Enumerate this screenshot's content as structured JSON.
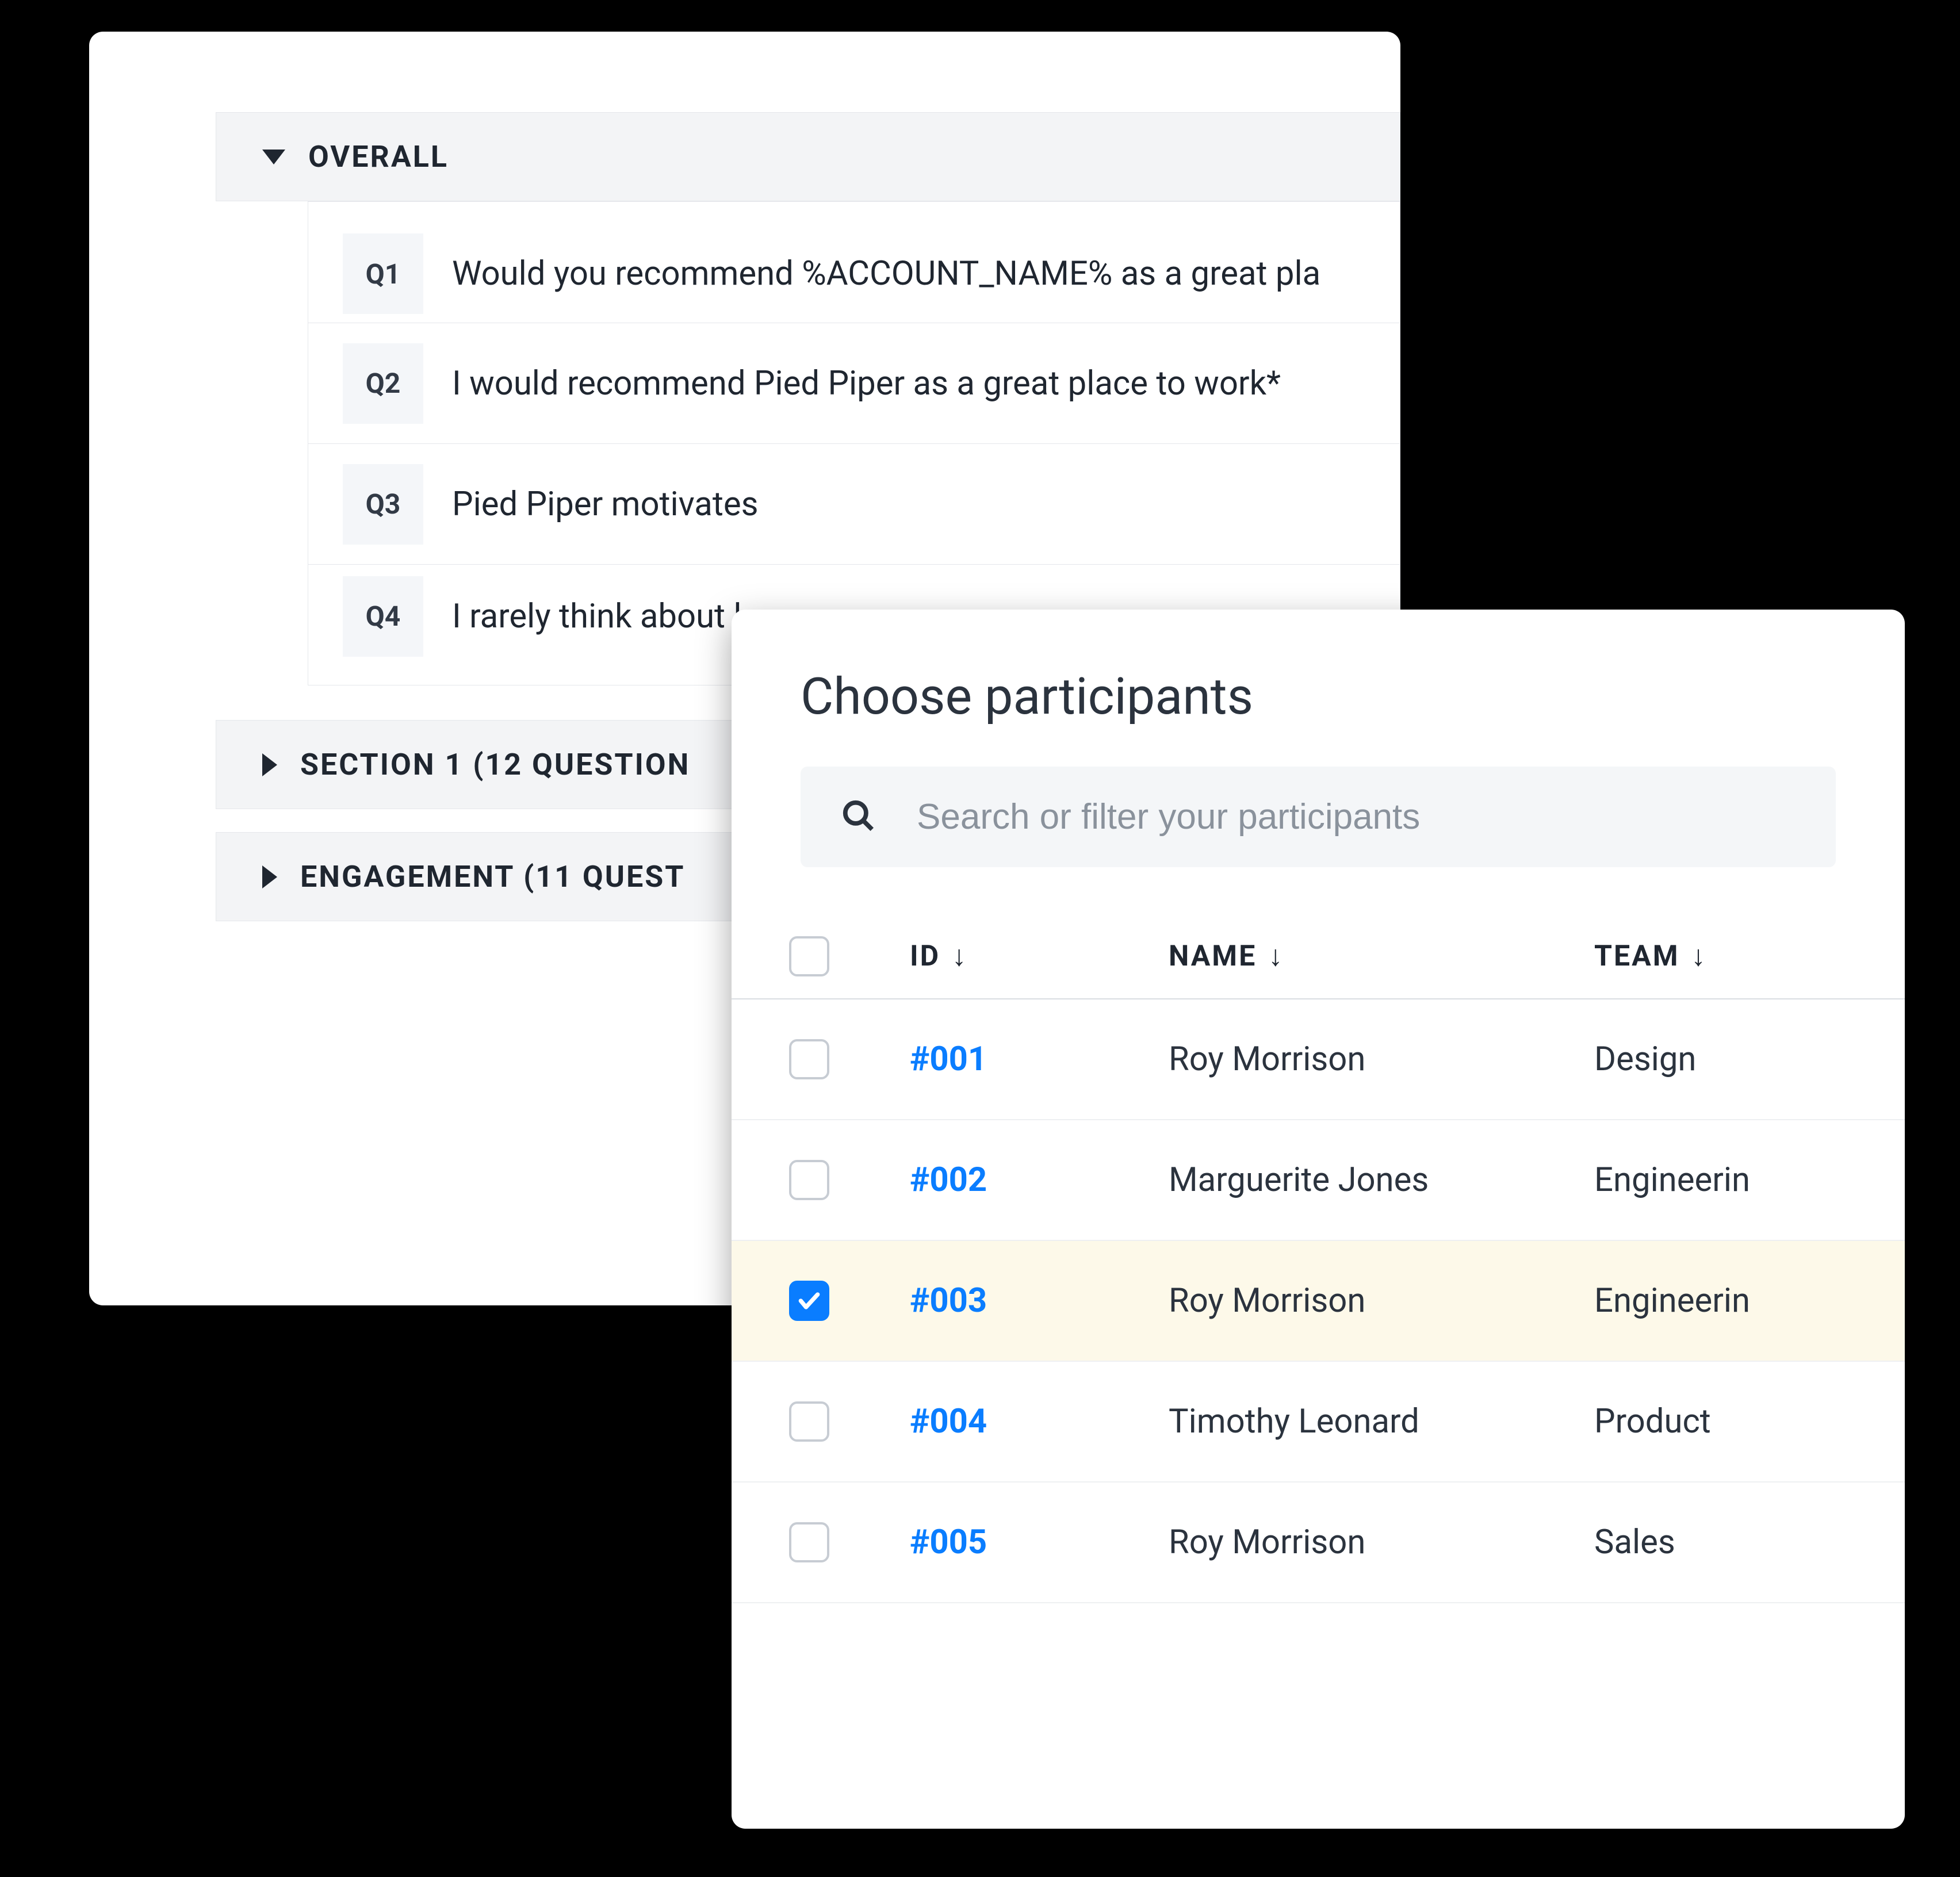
{
  "questions_panel": {
    "sections": [
      {
        "title": "OVERALL",
        "expanded": true,
        "items": [
          {
            "badge": "Q1",
            "text": "Would you recommend %ACCOUNT_NAME% as a great pla"
          },
          {
            "badge": "Q2",
            "text": "I would recommend Pied Piper as a great place to work*"
          },
          {
            "badge": "Q3",
            "text": "Pied Piper motivates"
          },
          {
            "badge": "Q4",
            "text": "I rarely think about l"
          }
        ]
      },
      {
        "title": "SECTION 1 (12 QUESTION",
        "expanded": false
      },
      {
        "title": "ENGAGEMENT (11 QUEST",
        "expanded": false
      }
    ]
  },
  "participants_panel": {
    "title": "Choose participants",
    "search_placeholder": "Search or filter your participants",
    "columns": {
      "id": "ID",
      "name": "NAME",
      "team": "TEAM"
    },
    "rows": [
      {
        "id": "#001",
        "name": "Roy Morrison",
        "team": "Design",
        "selected": false
      },
      {
        "id": "#002",
        "name": "Marguerite Jones",
        "team": "Engineerin",
        "selected": false
      },
      {
        "id": "#003",
        "name": "Roy Morrison",
        "team": "Engineerin",
        "selected": true
      },
      {
        "id": "#004",
        "name": "Timothy Leonard",
        "team": "Product",
        "selected": false
      },
      {
        "id": "#005",
        "name": "Roy Morrison",
        "team": "Sales",
        "selected": false
      }
    ]
  }
}
